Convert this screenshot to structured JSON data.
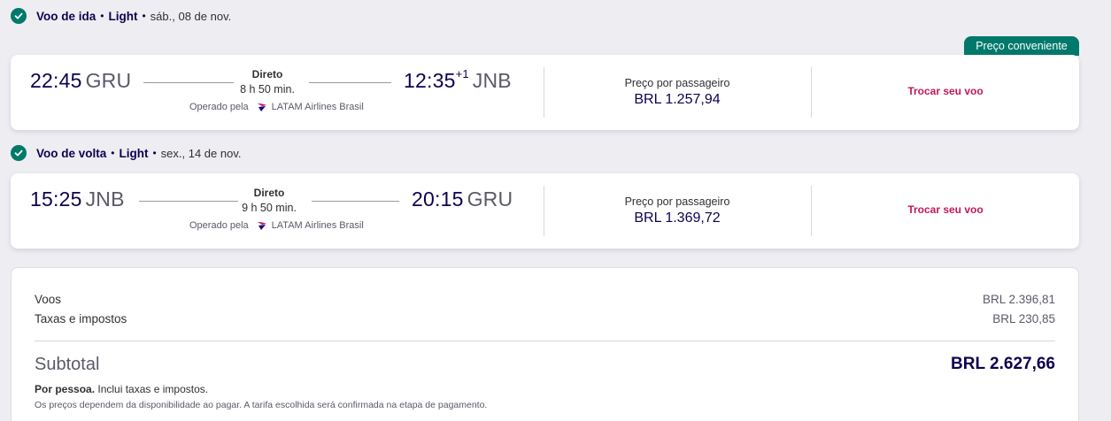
{
  "outbound": {
    "title": "Voo de ida",
    "fare_class": "Light",
    "date": "sáb., 08 de nov.",
    "badge": "Preço conveniente",
    "dep_time": "22:45",
    "dep_code": "GRU",
    "stops": "Direto",
    "duration": "8 h 50 min.",
    "arr_time": "12:35",
    "arr_day_offset": "+1",
    "arr_code": "JNB",
    "operated_by_label": "Operado pela",
    "airline": "LATAM Airlines Brasil",
    "price_label": "Preço por passageiro",
    "price": "BRL 1.257,94",
    "change_label": "Trocar seu voo"
  },
  "inbound": {
    "title": "Voo de volta",
    "fare_class": "Light",
    "date": "sex., 14 de nov.",
    "dep_time": "15:25",
    "dep_code": "JNB",
    "stops": "Direto",
    "duration": "9 h 50 min.",
    "arr_time": "20:15",
    "arr_code": "GRU",
    "operated_by_label": "Operado pela",
    "airline": "LATAM Airlines Brasil",
    "price_label": "Preço por passageiro",
    "price": "BRL 1.369,72",
    "change_label": "Trocar seu voo"
  },
  "summary": {
    "flights_label": "Voos",
    "flights_value": "BRL 2.396,81",
    "taxes_label": "Taxas e impostos",
    "taxes_value": "BRL 230,85",
    "subtotal_label": "Subtotal",
    "subtotal_value": "BRL 2.627,66",
    "per_person_bold": "Por pessoa.",
    "per_person_rest": " Inclui taxas e impostos.",
    "disclaimer": "Os preços dependem da disponibilidade ao pagar. A tarifa escolhida será confirmada na etapa de pagamento."
  },
  "colors": {
    "brand_navy": "#10004f",
    "accent_teal": "#00796b",
    "link_magenta": "#c2185b",
    "background": "#eeedf2"
  },
  "separator": "•"
}
